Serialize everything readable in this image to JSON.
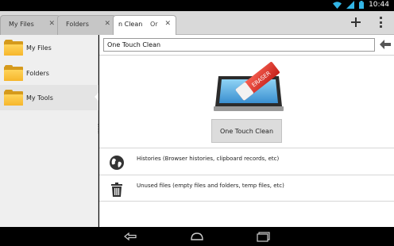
{
  "status_bar": {
    "time": "10:44",
    "icons": [
      "wifi-icon",
      "signal-icon",
      "battery-icon"
    ]
  },
  "tabs": [
    {
      "label": "My Files",
      "close": "✕"
    },
    {
      "label": "Folders",
      "close": "✕"
    },
    {
      "label": "n Clean",
      "label_cut": "Or",
      "close": "✕"
    }
  ],
  "actions": {
    "add_icon": "plus-icon",
    "overflow_icon": "overflow-menu-icon"
  },
  "sidebar": {
    "items": [
      {
        "label": "My Files"
      },
      {
        "label": "Folders"
      },
      {
        "label": "My Tools"
      }
    ]
  },
  "main": {
    "path": "One Touch Clean",
    "clean_button": "One Touch Clean",
    "rows": [
      {
        "text": "Histories (Browser histories, clipboard records, etc)",
        "icon": "globe-icon"
      },
      {
        "text": "Unused files (empty files and folders, temp files, etc)",
        "icon": "trash-icon"
      }
    ],
    "eraser_label": "ERASER"
  },
  "colors": {
    "accent": "#33b5e5",
    "folder": "#f6b62c"
  }
}
